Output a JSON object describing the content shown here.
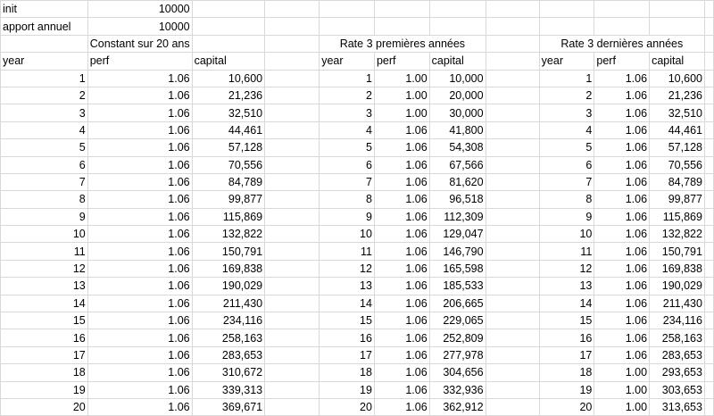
{
  "sheet": {
    "inputs": [
      {
        "label": "init",
        "value": "10000"
      },
      {
        "label": "apport annuel",
        "value": "10000"
      }
    ],
    "sections": [
      {
        "title": "Constant sur 20 ans",
        "headers": [
          "year",
          "perf",
          "capital"
        ]
      },
      {
        "title": "Rate 3 premières années",
        "headers": [
          "year",
          "perf",
          "capital"
        ]
      },
      {
        "title": "Rate 3 dernières années",
        "headers": [
          "year",
          "perf",
          "capital"
        ]
      }
    ],
    "rows": [
      [
        [
          "1",
          "1.06",
          "10,600"
        ],
        [
          "1",
          "1.00",
          "10,000"
        ],
        [
          "1",
          "1.06",
          "10,600"
        ]
      ],
      [
        [
          "2",
          "1.06",
          "21,236"
        ],
        [
          "2",
          "1.00",
          "20,000"
        ],
        [
          "2",
          "1.06",
          "21,236"
        ]
      ],
      [
        [
          "3",
          "1.06",
          "32,510"
        ],
        [
          "3",
          "1.00",
          "30,000"
        ],
        [
          "3",
          "1.06",
          "32,510"
        ]
      ],
      [
        [
          "4",
          "1.06",
          "44,461"
        ],
        [
          "4",
          "1.06",
          "41,800"
        ],
        [
          "4",
          "1.06",
          "44,461"
        ]
      ],
      [
        [
          "5",
          "1.06",
          "57,128"
        ],
        [
          "5",
          "1.06",
          "54,308"
        ],
        [
          "5",
          "1.06",
          "57,128"
        ]
      ],
      [
        [
          "6",
          "1.06",
          "70,556"
        ],
        [
          "6",
          "1.06",
          "67,566"
        ],
        [
          "6",
          "1.06",
          "70,556"
        ]
      ],
      [
        [
          "7",
          "1.06",
          "84,789"
        ],
        [
          "7",
          "1.06",
          "81,620"
        ],
        [
          "7",
          "1.06",
          "84,789"
        ]
      ],
      [
        [
          "8",
          "1.06",
          "99,877"
        ],
        [
          "8",
          "1.06",
          "96,518"
        ],
        [
          "8",
          "1.06",
          "99,877"
        ]
      ],
      [
        [
          "9",
          "1.06",
          "115,869"
        ],
        [
          "9",
          "1.06",
          "112,309"
        ],
        [
          "9",
          "1.06",
          "115,869"
        ]
      ],
      [
        [
          "10",
          "1.06",
          "132,822"
        ],
        [
          "10",
          "1.06",
          "129,047"
        ],
        [
          "10",
          "1.06",
          "132,822"
        ]
      ],
      [
        [
          "11",
          "1.06",
          "150,791"
        ],
        [
          "11",
          "1.06",
          "146,790"
        ],
        [
          "11",
          "1.06",
          "150,791"
        ]
      ],
      [
        [
          "12",
          "1.06",
          "169,838"
        ],
        [
          "12",
          "1.06",
          "165,598"
        ],
        [
          "12",
          "1.06",
          "169,838"
        ]
      ],
      [
        [
          "13",
          "1.06",
          "190,029"
        ],
        [
          "13",
          "1.06",
          "185,533"
        ],
        [
          "13",
          "1.06",
          "190,029"
        ]
      ],
      [
        [
          "14",
          "1.06",
          "211,430"
        ],
        [
          "14",
          "1.06",
          "206,665"
        ],
        [
          "14",
          "1.06",
          "211,430"
        ]
      ],
      [
        [
          "15",
          "1.06",
          "234,116"
        ],
        [
          "15",
          "1.06",
          "229,065"
        ],
        [
          "15",
          "1.06",
          "234,116"
        ]
      ],
      [
        [
          "16",
          "1.06",
          "258,163"
        ],
        [
          "16",
          "1.06",
          "252,809"
        ],
        [
          "16",
          "1.06",
          "258,163"
        ]
      ],
      [
        [
          "17",
          "1.06",
          "283,653"
        ],
        [
          "17",
          "1.06",
          "277,978"
        ],
        [
          "17",
          "1.06",
          "283,653"
        ]
      ],
      [
        [
          "18",
          "1.06",
          "310,672"
        ],
        [
          "18",
          "1.06",
          "304,656"
        ],
        [
          "18",
          "1.00",
          "293,653"
        ]
      ],
      [
        [
          "19",
          "1.06",
          "339,313"
        ],
        [
          "19",
          "1.06",
          "332,936"
        ],
        [
          "19",
          "1.00",
          "303,653"
        ]
      ],
      [
        [
          "20",
          "1.06",
          "369,671"
        ],
        [
          "20",
          "1.06",
          "362,912"
        ],
        [
          "20",
          "1.00",
          "313,653"
        ]
      ]
    ]
  }
}
